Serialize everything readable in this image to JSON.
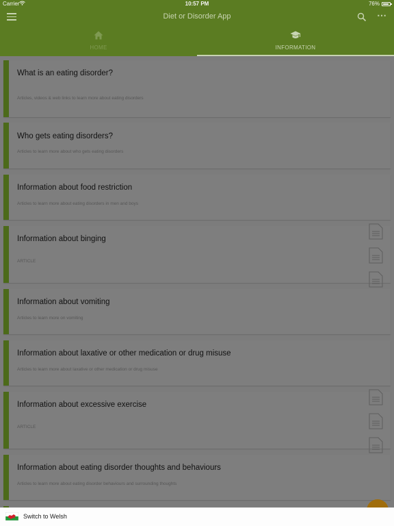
{
  "status_bar": {
    "carrier": "Carrier",
    "time": "10:57 PM",
    "battery": "76%",
    "battery_level": 0.76
  },
  "toolbar": {
    "title": "Diet or Disorder App",
    "menu_icon": "hamburger-menu-icon",
    "search_icon": "search-icon",
    "more_icon": "more-dots-icon"
  },
  "tabs": [
    {
      "label": "HOME",
      "icon": "home-icon",
      "selected": false
    },
    {
      "label": "INFORMATION",
      "icon": "graduation-cap-icon",
      "selected": true
    }
  ],
  "items": [
    {
      "title": "What is an eating disorder?",
      "subtitle": "Articles, videos & web links to learn more about eating disorders",
      "has_doc_icons": false
    },
    {
      "title": "Who gets eating disorders?",
      "subtitle": "Articles to learn more about who gets eating disorders",
      "has_doc_icons": false
    },
    {
      "title": "Information about food restriction",
      "subtitle": "Articles to learn more about eating disorders in men and boys",
      "has_doc_icons": false
    },
    {
      "title": "Information about binging",
      "subtitle": "ARTICLE",
      "has_doc_icons": true
    },
    {
      "title": "Information about vomiting",
      "subtitle": "Articles to learn more on vomiting",
      "has_doc_icons": false
    },
    {
      "title": "Information about laxative or other medication or drug misuse",
      "subtitle": "Articles to learn more about laxative or other medication or drug misuse",
      "has_doc_icons": false
    },
    {
      "title": "Information about excessive exercise",
      "subtitle": "ARTICLE",
      "has_doc_icons": true
    },
    {
      "title": "Information about eating disorder thoughts and behaviours",
      "subtitle": "Articles to learn more about eating disorder behaviours and surrounding thoughts",
      "has_doc_icons": false
    }
  ],
  "bottom_bar": {
    "label": "Switch to Welsh",
    "flag_icon": "welsh-flag-icon"
  },
  "colors": {
    "header_green": "#5b7c22",
    "card_accent": "#4c6a1a",
    "overlay_gray": "#7c7c7c",
    "fab": "#a06d0c"
  }
}
